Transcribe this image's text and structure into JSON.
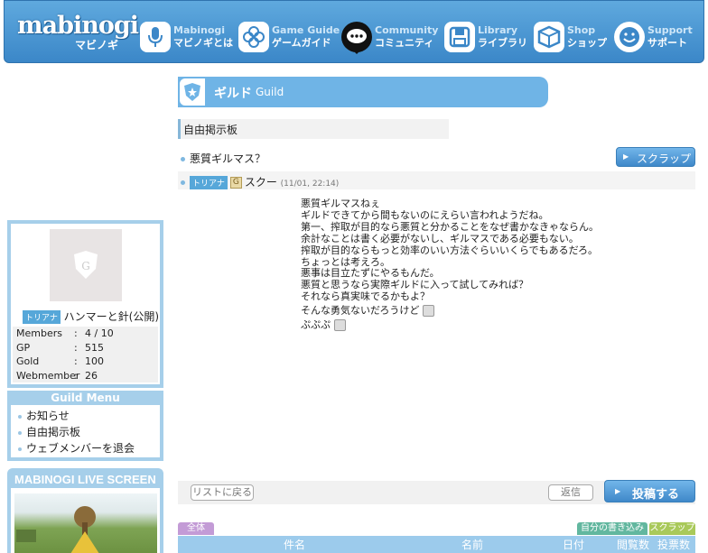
{
  "header": {
    "logo_main": "mabinogi",
    "logo_sub": "マビノギ",
    "nav": [
      {
        "en": "Mabinogi",
        "jp": "マビノギとは",
        "icon": "microphone-icon"
      },
      {
        "en": "Game Guide",
        "jp": "ゲームガイド",
        "icon": "flower-icon"
      },
      {
        "en": "Community",
        "jp": "コミュニティ",
        "icon": "speech-bubble-icon"
      },
      {
        "en": "Library",
        "jp": "ライブラリ",
        "icon": "floppy-icon"
      },
      {
        "en": "Shop",
        "jp": "ショップ",
        "icon": "box-icon"
      },
      {
        "en": "Support",
        "jp": "サポート",
        "icon": "smile-icon"
      }
    ]
  },
  "guild": {
    "title_jp": "ギルド",
    "title_en": "Guild",
    "board": "自由掲示板"
  },
  "post": {
    "subject": "悪質ギルマス？",
    "scrap_label": "スクラップ",
    "server_tag": "トリアナ",
    "guild_icon": "G",
    "author": "スクー",
    "date": "(11/01, 22:14)",
    "lines": [
      "悪質ギルマスねぇ",
      "ギルドできてから間もないのにえらい言われようだね。",
      "第一、搾取が目的なら悪質と分かることをなぜ書かなきゃならん。",
      "余計なことは書く必要がないし、ギルマスである必要もない。",
      "搾取が目的ならもっと効率のいい方法ぐらいいくらでもあるだろ。",
      "ちょっとは考えろ。",
      "悪事は目立たずにやるもんだ。",
      "悪質と思うなら実際ギルドに入って試してみれば？",
      "それなら真実味でるかもよ？",
      "そんな勇気ないだろうけど",
      "ぷぷぷ"
    ]
  },
  "actions": {
    "back_to_list": "リストに戻る",
    "reply": "返信",
    "post": "投稿する"
  },
  "list": {
    "tab_all": "全体",
    "tab_mine": "自分の書き込み",
    "tab_scrap": "スクラップ",
    "columns": [
      "件名",
      "名前",
      "日付",
      "閲覧数",
      "投票数"
    ]
  },
  "sidebar": {
    "server_tag": "トリアナ",
    "guild_name": "ハンマーと針(公開)",
    "stats": [
      {
        "key": "Members",
        "value": "4 / 10"
      },
      {
        "key": "GP",
        "value": "515"
      },
      {
        "key": "Gold",
        "value": "100"
      },
      {
        "key": "Webmember",
        "value": "26"
      }
    ],
    "menu_title": "Guild Menu",
    "menu": [
      "お知らせ",
      "自由掲示板",
      "ウェブメンバーを退会"
    ],
    "live_title": "MABINOGI LIVE SCREEN"
  },
  "colors": {
    "brand_blue": "#3b87c8",
    "sidebar_border": "#a6cfea",
    "tab_all": "#c39bd6",
    "tab_mine": "#62b79f",
    "tab_scrap": "#a9c95a"
  }
}
